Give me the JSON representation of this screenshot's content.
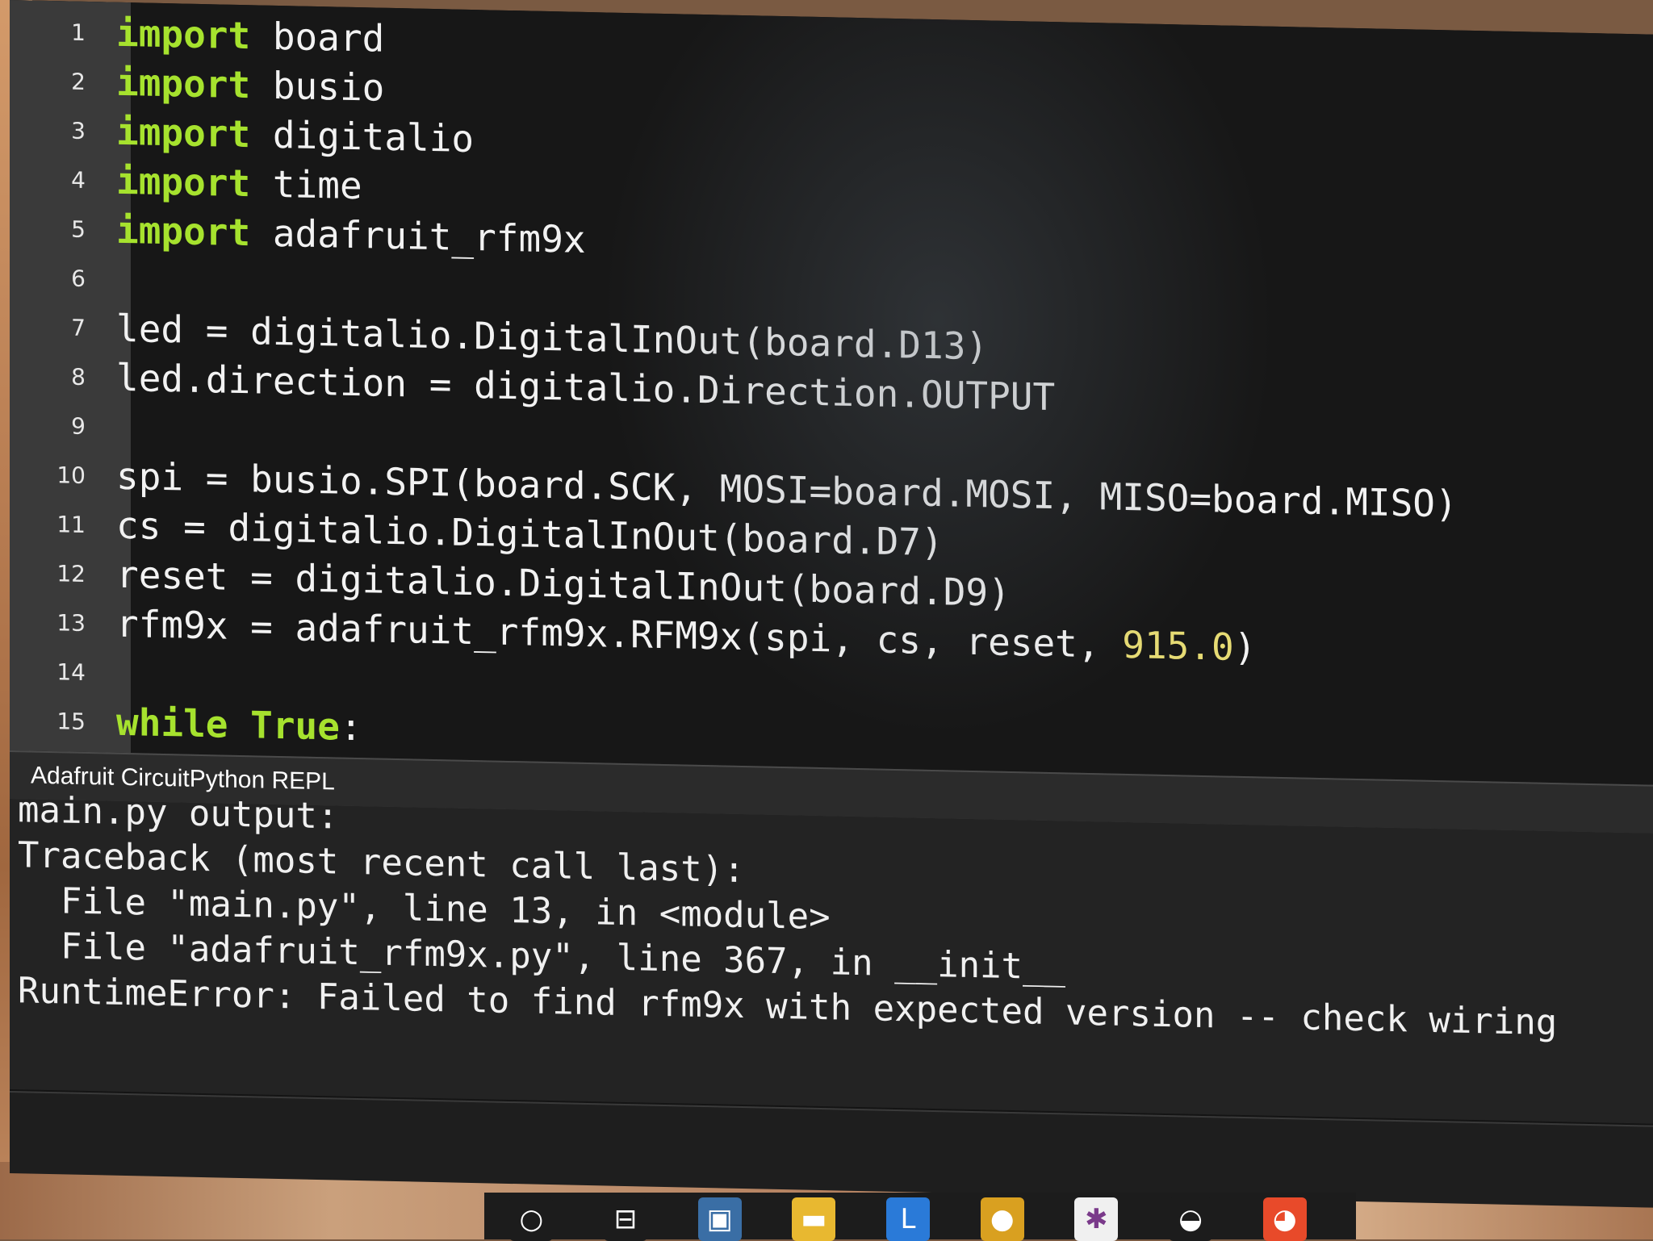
{
  "editor": {
    "lines": [
      {
        "n": "1",
        "segments": [
          [
            "kw",
            "import"
          ],
          [
            "t",
            " board"
          ]
        ]
      },
      {
        "n": "2",
        "segments": [
          [
            "kw",
            "import"
          ],
          [
            "t",
            " busio"
          ]
        ]
      },
      {
        "n": "3",
        "segments": [
          [
            "kw",
            "import"
          ],
          [
            "t",
            " digitalio"
          ]
        ]
      },
      {
        "n": "4",
        "segments": [
          [
            "kw",
            "import"
          ],
          [
            "t",
            " time"
          ]
        ]
      },
      {
        "n": "5",
        "segments": [
          [
            "kw",
            "import"
          ],
          [
            "t",
            " adafruit_rfm9x"
          ]
        ]
      },
      {
        "n": "6",
        "segments": []
      },
      {
        "n": "7",
        "segments": [
          [
            "t",
            "led = digitalio.DigitalInOut(board.D13)"
          ]
        ]
      },
      {
        "n": "8",
        "segments": [
          [
            "t",
            "led.direction = digitalio.Direction.OUTPUT"
          ]
        ]
      },
      {
        "n": "9",
        "segments": []
      },
      {
        "n": "10",
        "segments": [
          [
            "t",
            "spi = busio.SPI(board.SCK, MOSI=board.MOSI, MISO=board.MISO)"
          ]
        ]
      },
      {
        "n": "11",
        "segments": [
          [
            "t",
            "cs = digitalio.DigitalInOut(board.D7)"
          ]
        ]
      },
      {
        "n": "12",
        "segments": [
          [
            "t",
            "reset = digitalio.DigitalInOut(board.D9)"
          ]
        ]
      },
      {
        "n": "13",
        "segments": [
          [
            "t",
            "rfm9x = adafruit_rfm9x.RFM9x(spi, cs, reset, "
          ],
          [
            "num",
            "915.0"
          ],
          [
            "t",
            ")"
          ]
        ]
      },
      {
        "n": "14",
        "segments": []
      },
      {
        "n": "15",
        "segments": [
          [
            "kw",
            "while True"
          ],
          [
            "t",
            ":"
          ]
        ]
      }
    ]
  },
  "repl": {
    "title": "Adafruit CircuitPython REPL",
    "output": [
      "main.py output:",
      "Traceback (most recent call last):",
      "  File \"main.py\", line 13, in <module>",
      "  File \"adafruit_rfm9x.py\", line 367, in __init__",
      "RuntimeError: Failed to find rfm9x with expected version -- check wiring"
    ]
  },
  "taskbar": {
    "items": [
      {
        "name": "search-icon",
        "glyph": "○",
        "color": "#1c1c1c"
      },
      {
        "name": "task-view-icon",
        "glyph": "⊟",
        "color": "#1c1c1c"
      },
      {
        "name": "store-icon",
        "glyph": "▣",
        "color": "#3a6ea5"
      },
      {
        "name": "file-explorer-icon",
        "glyph": "▬",
        "color": "#e8b830"
      },
      {
        "name": "app-l-icon",
        "glyph": "L",
        "color": "#2a7ad8"
      },
      {
        "name": "chrome-icon",
        "glyph": "●",
        "color": "#d9a020"
      },
      {
        "name": "slack-icon",
        "glyph": "✱",
        "color": "#f0f0f0"
      },
      {
        "name": "game-icon",
        "glyph": "◒",
        "color": "#1c1c1c"
      },
      {
        "name": "app-red-icon",
        "glyph": "◕",
        "color": "#e84a2a"
      }
    ]
  }
}
